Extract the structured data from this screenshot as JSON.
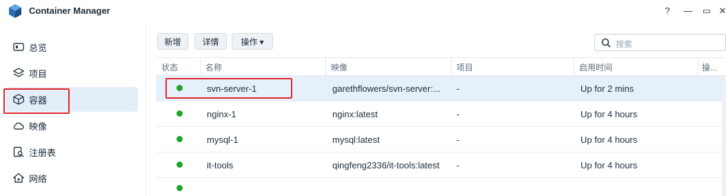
{
  "app": {
    "title": "Container Manager"
  },
  "window": {
    "help": "?",
    "minimize": "—",
    "maximize": "▭",
    "close": "✕"
  },
  "sidebar": {
    "items": [
      {
        "label": "总览",
        "icon": "overview-icon"
      },
      {
        "label": "项目",
        "icon": "layers-icon"
      },
      {
        "label": "容器",
        "icon": "cube-icon",
        "active": true
      },
      {
        "label": "映像",
        "icon": "cloud-icon"
      },
      {
        "label": "注册表",
        "icon": "registry-search-icon"
      },
      {
        "label": "网络",
        "icon": "network-house-icon"
      }
    ]
  },
  "toolbar": {
    "new_label": "新增",
    "details_label": "详情",
    "actions_label": "操作 ▾"
  },
  "search": {
    "placeholder": "搜索"
  },
  "table": {
    "columns": [
      "状态",
      "名称",
      "映像",
      "项目",
      "启用时间",
      "操..."
    ],
    "rows": [
      {
        "status": "running",
        "name": "svn-server-1",
        "image": "garethflowers/svn-server:...",
        "project": "-",
        "uptime": "Up for 2 mins",
        "selected": true
      },
      {
        "status": "running",
        "name": "nginx-1",
        "image": "nginx:latest",
        "project": "-",
        "uptime": "Up for 4 hours"
      },
      {
        "status": "running",
        "name": "mysql-1",
        "image": "mysql:latest",
        "project": "-",
        "uptime": "Up for 4 hours"
      },
      {
        "status": "running",
        "name": "it-tools",
        "image": "qingfeng2336/it-tools:latest",
        "project": "-",
        "uptime": "Up for 4 hours"
      }
    ]
  },
  "colors": {
    "running": "#1fa32a",
    "selection": "#e6f0fb",
    "highlight_box": "#e0242b"
  }
}
